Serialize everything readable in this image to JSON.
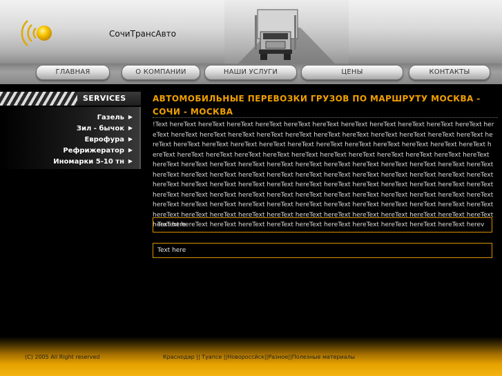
{
  "header": {
    "site_title": "СочиТрансАвто"
  },
  "nav": {
    "items": [
      "ГЛАВНАЯ",
      "О КОМПАНИИ",
      "НАШИ УСЛУГИ",
      "ЦЕНЫ",
      "КОНТАКТЫ"
    ]
  },
  "sidebar": {
    "heading": "SERVICES",
    "items": [
      "Газель",
      "Зил - бычок",
      "Еврофура",
      "Рефрижератор",
      "Иномарки 5-10 тн"
    ],
    "arrow": "▶"
  },
  "main": {
    "title": "АВТОМОБИЛЬНЫЕ ПЕРЕВОЗКИ ГРУЗОВ ПО МАРШРУТУ МОСКВА - СОЧИ - МОСКВА",
    "body": "!Text hereText hereText hereText hereText hereText hereText hereText hereText hereText hereText hereText hereText hereText hereText hereText hereText hereText hereText hereText hereText hereText hereText hereText hereText hereText hereText hereText hereText hereText hereText hereText hereText hereText hereText hereText hereText hereText hereText hereText hereText hereText hereText hereText hereText hereText hereText hereText hereText hereText hereText hereText hereText hereText hereText hereText hereText hereText hereText hereText hereText hereText hereText hereText hereText hereText hereText hereText hereText hereText hereText hereText hereText hereText hereText hereText hereText hereText hereText hereText hereText hereText hereText hereText hereText hereText hereText hereText hereText hereText hereText hereText hereText hereText hereText hereText hereText hereText hereText hereText hereText hereText hereText hereText hereText hereText hereText hereText hereText hereText hereText hereText hereText hereText hereText hereText hereText hereText hereText hereText hereText hereText hereText hereText hereText hereText hereText hereText hereText hereText hereText herev",
    "box1": "Text here",
    "box2": "Text here"
  },
  "footer": {
    "copyright": "(C) 2005 All Right reserved",
    "links": [
      "Краснодар",
      "Туапсе",
      "Новороссйск",
      "Разное",
      "Полезные материалы"
    ],
    "separators": [
      " || ",
      " ||",
      "||",
      "||"
    ]
  },
  "colors": {
    "accent": "#f0a000",
    "box_border": "#d99400",
    "logo_yellow": "#f5c400"
  },
  "icons": {
    "logo": "radio-wave-sun-icon",
    "sidebar_arrow": "triangle-right-icon"
  }
}
